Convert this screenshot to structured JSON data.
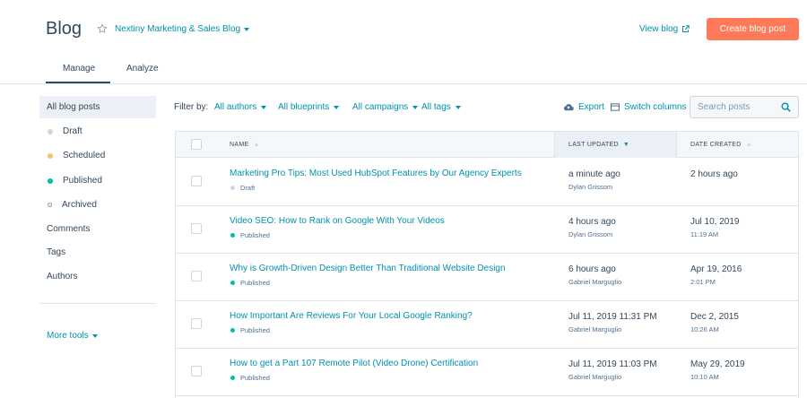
{
  "header": {
    "title": "Blog",
    "blog_name": "Nextiny Marketing & Sales Blog",
    "view_blog": "View blog",
    "create_button": "Create blog post"
  },
  "tabs": [
    {
      "label": "Manage",
      "active": true
    },
    {
      "label": "Analyze",
      "active": false
    }
  ],
  "sidebar": {
    "items": [
      {
        "label": "All blog posts",
        "active": true
      },
      {
        "label": "Draft",
        "dot": "#cbd6e2"
      },
      {
        "label": "Scheduled",
        "dot": "#f5c26b"
      },
      {
        "label": "Published",
        "dot": "#00bda5"
      },
      {
        "label": "Archived",
        "dot": "hollow"
      },
      {
        "label": "Comments"
      },
      {
        "label": "Tags"
      },
      {
        "label": "Authors"
      }
    ],
    "more_tools": "More tools"
  },
  "filters": {
    "label": "Filter by:",
    "authors": "All authors",
    "blueprints": "All blueprints",
    "campaigns": "All campaigns",
    "tags": "All tags",
    "export": "Export",
    "switch_columns": "Switch columns",
    "search_placeholder": "Search posts"
  },
  "table": {
    "columns": {
      "name": "Name",
      "last_updated": "Last updated",
      "date_created": "Date created"
    },
    "rows": [
      {
        "title": "Marketing Pro Tips: Most Used HubSpot Features by Our Agency Experts",
        "status": "Draft",
        "status_color": "#cbd6e2",
        "updated": "a minute ago",
        "updated_by": "Dylan Grissom",
        "created": "2 hours ago",
        "created_time": ""
      },
      {
        "title": "Video SEO: How to Rank on Google With Your Videos",
        "status": "Published",
        "status_color": "#00bda5",
        "updated": "4 hours ago",
        "updated_by": "Dylan Grissom",
        "created": "Jul 10, 2019",
        "created_time": "11:19 AM"
      },
      {
        "title": "Why is Growth-Driven Design Better Than Traditional Website Design",
        "status": "Published",
        "status_color": "#00bda5",
        "updated": "6 hours ago",
        "updated_by": "Gabriel Marguglio",
        "created": "Apr 19, 2016",
        "created_time": "2:01 PM"
      },
      {
        "title": "How Important Are Reviews For Your Local Google Ranking?",
        "status": "Published",
        "status_color": "#00bda5",
        "updated": "Jul 11, 2019 11:31 PM",
        "updated_by": "Gabriel Marguglio",
        "created": "Dec 2, 2015",
        "created_time": "10:26 AM"
      },
      {
        "title": "How to get a Part 107 Remote Pilot (Video Drone) Certification",
        "status": "Published",
        "status_color": "#00bda5",
        "updated": "Jul 11, 2019 11:03 PM",
        "updated_by": "Gabriel Marguglio",
        "created": "May 29, 2019",
        "created_time": "10:10 AM"
      }
    ]
  },
  "colors": {
    "accent": "#0091ae",
    "primary_button": "#ff7a59",
    "text": "#33475b"
  }
}
